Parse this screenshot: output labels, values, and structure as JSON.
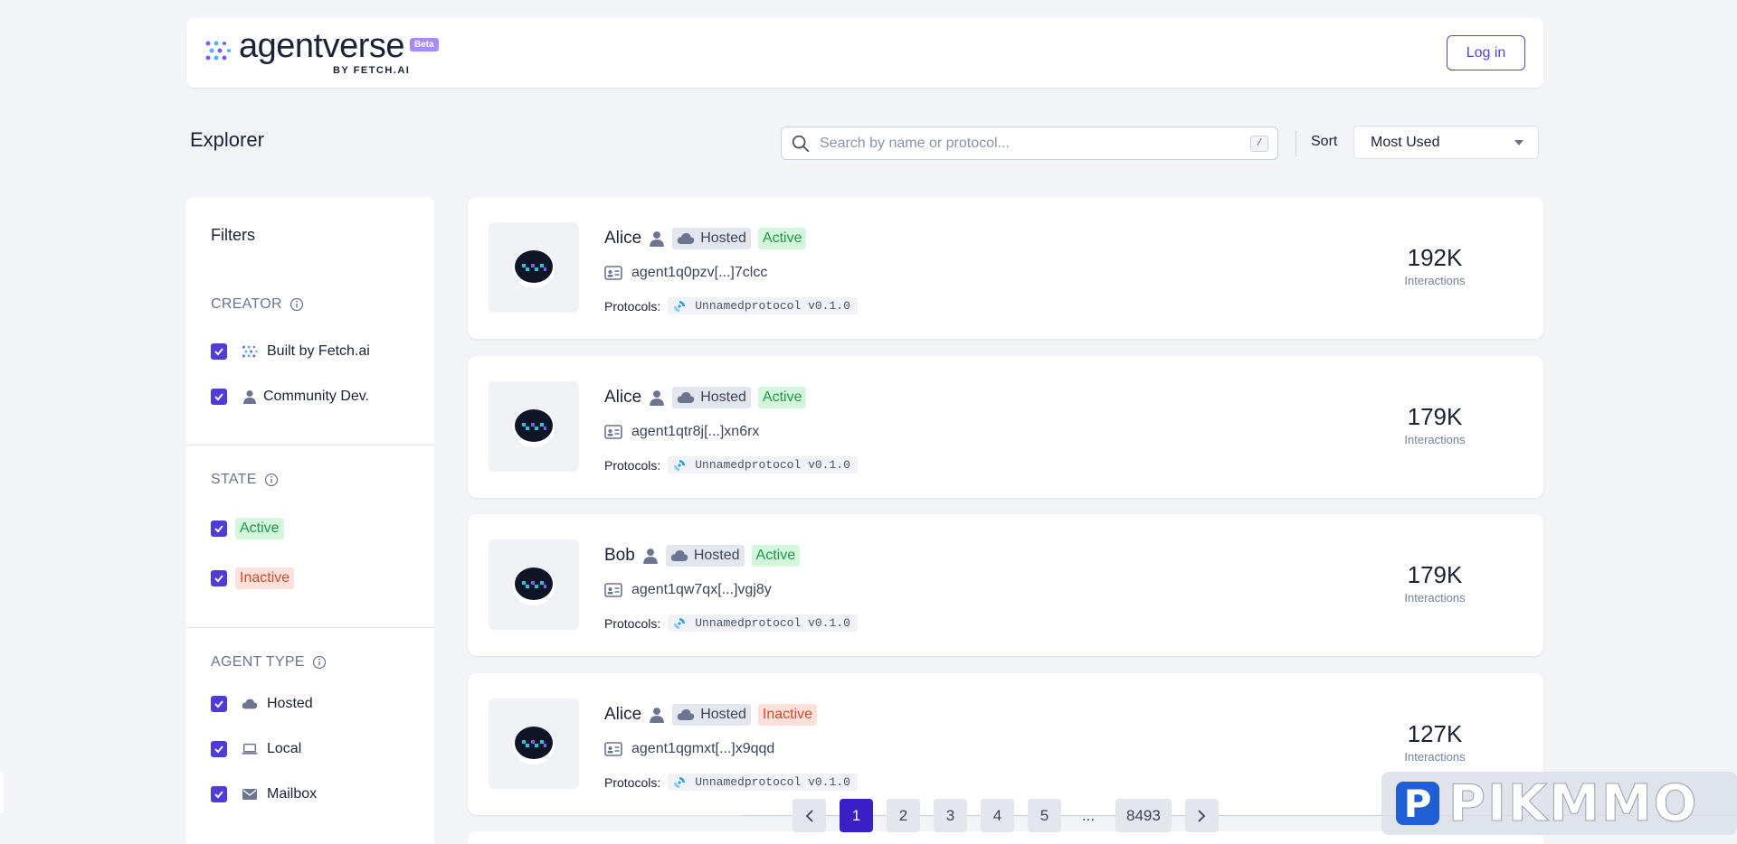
{
  "brand": {
    "name": "agentverse",
    "badge": "Beta",
    "byline": "BY FETCH.AI"
  },
  "header": {
    "login_label": "Log in"
  },
  "page": {
    "title": "Explorer"
  },
  "search": {
    "placeholder": "Search by name or protocol...",
    "shortcut": "/"
  },
  "sort": {
    "label": "Sort",
    "selected": "Most Used"
  },
  "filters": {
    "title": "Filters",
    "creator": {
      "heading": "CREATOR",
      "options": [
        "Built by Fetch.ai",
        "Community Dev."
      ]
    },
    "state": {
      "heading": "STATE",
      "options": [
        "Active",
        "Inactive"
      ]
    },
    "agent_type": {
      "heading": "AGENT TYPE",
      "options": [
        "Hosted",
        "Local",
        "Mailbox"
      ]
    }
  },
  "agents": [
    {
      "name": "Alice",
      "type": "Hosted",
      "status": "Active",
      "address": "agent1q0pzv[...]7clcc",
      "protocols_label": "Protocols:",
      "protocol": "Unnamedprotocol v0.1.0",
      "interactions": "192K",
      "interactions_label": "Interactions"
    },
    {
      "name": "Alice",
      "type": "Hosted",
      "status": "Active",
      "address": "agent1qtr8j[...]xn6rx",
      "protocols_label": "Protocols:",
      "protocol": "Unnamedprotocol v0.1.0",
      "interactions": "179K",
      "interactions_label": "Interactions"
    },
    {
      "name": "Bob",
      "type": "Hosted",
      "status": "Active",
      "address": "agent1qw7qx[...]vgj8y",
      "protocols_label": "Protocols:",
      "protocol": "Unnamedprotocol v0.1.0",
      "interactions": "179K",
      "interactions_label": "Interactions"
    },
    {
      "name": "Alice",
      "type": "Hosted",
      "status": "Inactive",
      "address": "agent1qgmxt[...]x9qqd",
      "protocols_label": "Protocols:",
      "protocol": "Unnamedprotocol v0.1.0",
      "interactions": "127K",
      "interactions_label": "Interactions"
    }
  ],
  "pagination": {
    "pages": [
      "1",
      "2",
      "3",
      "4",
      "5"
    ],
    "ellipsis": "...",
    "last": "8493",
    "current": "1"
  },
  "watermark": {
    "text": "PIKMMO",
    "letter": "P"
  },
  "colors": {
    "accent": "#4f3bd6",
    "active_bg": "#d3f6dc",
    "inactive_bg": "#fde0d9"
  }
}
